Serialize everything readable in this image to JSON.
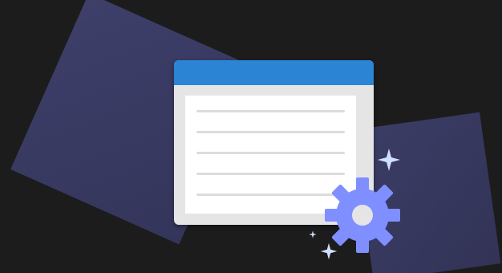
{
  "illustration": {
    "icons": [
      "document-window-icon",
      "gear-icon",
      "sparkle-icon"
    ],
    "colors": {
      "background": "#1c1c1d",
      "panel": "#3a3b63",
      "titlebar": "#2b84d4",
      "window": "#e5e5e5",
      "gear": "#7f8fff",
      "sparkle": "#cfe0ff"
    }
  }
}
